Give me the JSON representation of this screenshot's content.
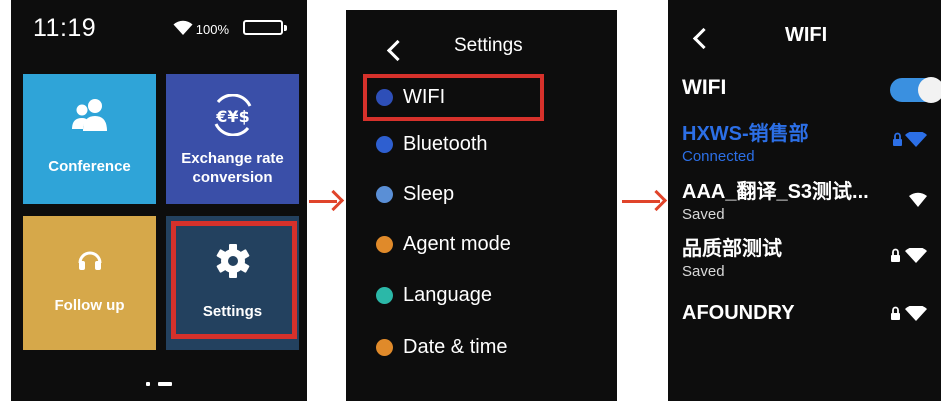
{
  "home": {
    "time": "11:19",
    "battery": "100%",
    "tiles": [
      {
        "label": "Conference",
        "color": "#2fa4d8"
      },
      {
        "label": "Exchange rate\nconversion",
        "color": "#3a4fa8"
      },
      {
        "label": "Follow up",
        "color": "#d6a84a"
      },
      {
        "label": "Settings",
        "color": "#23415f"
      }
    ],
    "icons": {
      "conference": "people-icon",
      "exchange": "currency-icon",
      "follow_up": "headphones-icon",
      "settings": "gear-icon"
    }
  },
  "settings_screen": {
    "title": "Settings",
    "items": [
      {
        "label": "WIFI",
        "color": "#2e4fb8"
      },
      {
        "label": "Bluetooth",
        "color": "#2e5fd0"
      },
      {
        "label": "Sleep",
        "color": "#5a8fd6"
      },
      {
        "label": "Agent mode",
        "color": "#e08a2a"
      },
      {
        "label": "Language",
        "color": "#2bb8a8"
      },
      {
        "label": "Date & time",
        "color": "#e08a2a"
      }
    ]
  },
  "wifi_screen": {
    "title": "WIFI",
    "toggle_label": "WIFI",
    "toggle_on": true,
    "networks": [
      {
        "name": "HXWS-销售部",
        "status": "Connected",
        "locked": true,
        "active": true
      },
      {
        "name": "AAA_翻译_S3测试...",
        "status": "Saved",
        "locked": false,
        "active": false
      },
      {
        "name": "品质部测试",
        "status": "Saved",
        "locked": true,
        "active": false
      },
      {
        "name": "AFOUNDRY",
        "status": "",
        "locked": true,
        "active": false
      }
    ]
  },
  "colors": {
    "highlight": "#d6312b",
    "arrow": "#e0442a",
    "accent": "#2c6fe6"
  }
}
